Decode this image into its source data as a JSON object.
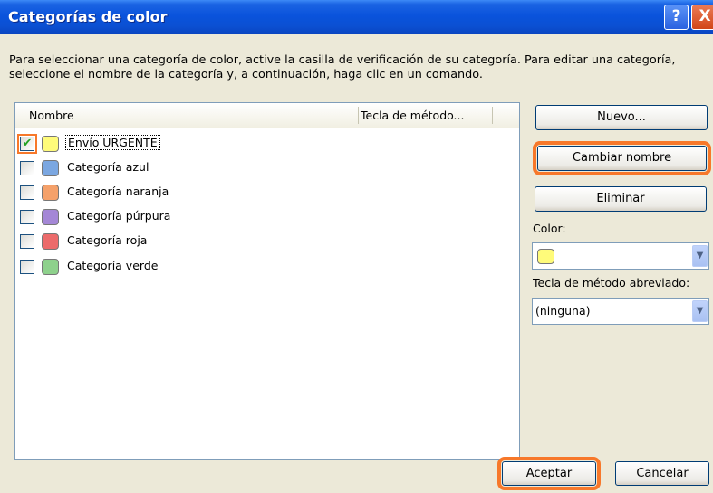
{
  "window": {
    "title": "Categorías de color",
    "help_label": "?",
    "close_label": "X"
  },
  "instructions": "Para seleccionar una categoría de color, active la casilla de verificación de su categoría. Para editar una categoría, seleccione el nombre de la categoría y, a continuación, haga clic en un comando.",
  "list": {
    "columns": [
      "Nombre",
      "Tecla de método..."
    ],
    "items": [
      {
        "label": "Envío URGENTE",
        "checked": true,
        "color": "#fffb7a"
      },
      {
        "label": "Categoría azul",
        "checked": false,
        "color": "#7ba7e1"
      },
      {
        "label": "Categoría naranja",
        "checked": false,
        "color": "#f5a16a"
      },
      {
        "label": "Categoría púrpura",
        "checked": false,
        "color": "#a487d6"
      },
      {
        "label": "Categoría roja",
        "checked": false,
        "color": "#ec6b6b"
      },
      {
        "label": "Categoría verde",
        "checked": false,
        "color": "#8ed18c"
      }
    ]
  },
  "buttons": {
    "new": "Nuevo...",
    "rename": "Cambiar nombre",
    "delete": "Eliminar",
    "ok": "Aceptar",
    "cancel": "Cancelar"
  },
  "color": {
    "label": "Color:",
    "selected_color": "#fffb7a"
  },
  "shortcut": {
    "label": "Tecla de método abreviado:",
    "value": "(ninguna)"
  },
  "check_mark": "✔",
  "dropdown_arrow": "▼",
  "highlight_color": "#f7782a"
}
